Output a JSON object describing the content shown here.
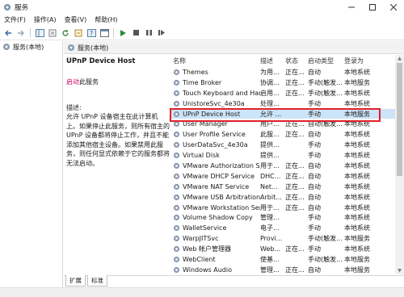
{
  "window": {
    "title": "服务"
  },
  "menu": [
    "文件(F)",
    "操作(A)",
    "查看(V)",
    "帮助(H)"
  ],
  "tree": {
    "item": "服务(本地)"
  },
  "header": {
    "title": "服务(本地)"
  },
  "detail": {
    "service_name": "UPnP Device Host",
    "start_link": "启动",
    "start_suffix": "此服务",
    "desc_label": "描述:",
    "desc_text": "允许 UPnP 设备宿主在此计算机上。如果停止此服务，则所有宿主的 UPnP 设备都将停止工作，并且不能添加其他宿主设备。如果禁用此服务，则任何显式依赖于它的服务都将无法启动。"
  },
  "columns": {
    "name": "名称",
    "desc": "描述",
    "status": "状态",
    "startup": "启动类型",
    "logon": "登录为"
  },
  "services": [
    {
      "name": "Themes",
      "desc": "为用...",
      "status": "正在...",
      "startup": "自动",
      "logon": "本地系统"
    },
    {
      "name": "Time Broker",
      "desc": "协调...",
      "status": "正在...",
      "startup": "手动(触发...",
      "logon": "本地服务"
    },
    {
      "name": "Touch Keyboard and Hand...",
      "desc": "启用...",
      "status": "正在...",
      "startup": "手动(触发...",
      "logon": "本地系统"
    },
    {
      "name": "UnistoreSvc_4e30a",
      "desc": "处理...",
      "status": "",
      "startup": "手动",
      "logon": "本地系统"
    },
    {
      "name": "UPnP Device Host",
      "desc": "允许 ...",
      "status": "",
      "startup": "手动",
      "logon": "本地服务"
    },
    {
      "name": "User Manager",
      "desc": "用户...",
      "status": "正在...",
      "startup": "自动(触发...",
      "logon": "本地系统"
    },
    {
      "name": "User Profile Service",
      "desc": "此服...",
      "status": "正在...",
      "startup": "自动",
      "logon": "本地系统"
    },
    {
      "name": "UserDataSvc_4e30a",
      "desc": "提供...",
      "status": "",
      "startup": "手动",
      "logon": "本地系统"
    },
    {
      "name": "Virtual Disk",
      "desc": "提供...",
      "status": "",
      "startup": "手动",
      "logon": "本地系统"
    },
    {
      "name": "VMware Authorization Ser...",
      "desc": "用于...",
      "status": "正在...",
      "startup": "自动",
      "logon": "本地系统"
    },
    {
      "name": "VMware DHCP Service",
      "desc": "DHC...",
      "status": "正在...",
      "startup": "自动",
      "logon": "本地系统"
    },
    {
      "name": "VMware NAT Service",
      "desc": "Net...",
      "status": "正在...",
      "startup": "自动",
      "logon": "本地系统"
    },
    {
      "name": "VMware USB Arbitration S...",
      "desc": "Arbit...",
      "status": "正在...",
      "startup": "自动",
      "logon": "本地系统"
    },
    {
      "name": "VMware Workstation Server",
      "desc": "用于...",
      "status": "正在...",
      "startup": "自动",
      "logon": "本地系统"
    },
    {
      "name": "Volume Shadow Copy",
      "desc": "管理...",
      "status": "",
      "startup": "手动",
      "logon": "本地系统"
    },
    {
      "name": "WalletService",
      "desc": "电子...",
      "status": "",
      "startup": "手动",
      "logon": "本地系统"
    },
    {
      "name": "WarpJITSvc",
      "desc": "Provi...",
      "status": "",
      "startup": "手动(触发...",
      "logon": "本地服务"
    },
    {
      "name": "Web 帐户管理器",
      "desc": "Web...",
      "status": "正在...",
      "startup": "手动",
      "logon": "本地系统"
    },
    {
      "name": "WebClient",
      "desc": "使基...",
      "status": "",
      "startup": "手动(触发...",
      "logon": "本地服务"
    },
    {
      "name": "Windows Audio",
      "desc": "管理...",
      "status": "正在...",
      "startup": "自动",
      "logon": "本地服务"
    }
  ],
  "selected_index": 4,
  "tabs": [
    "扩展",
    "标准"
  ],
  "colors": {
    "selection": "#cce4f7",
    "highlight_border": "#e0202a",
    "link": "#cc0066"
  }
}
